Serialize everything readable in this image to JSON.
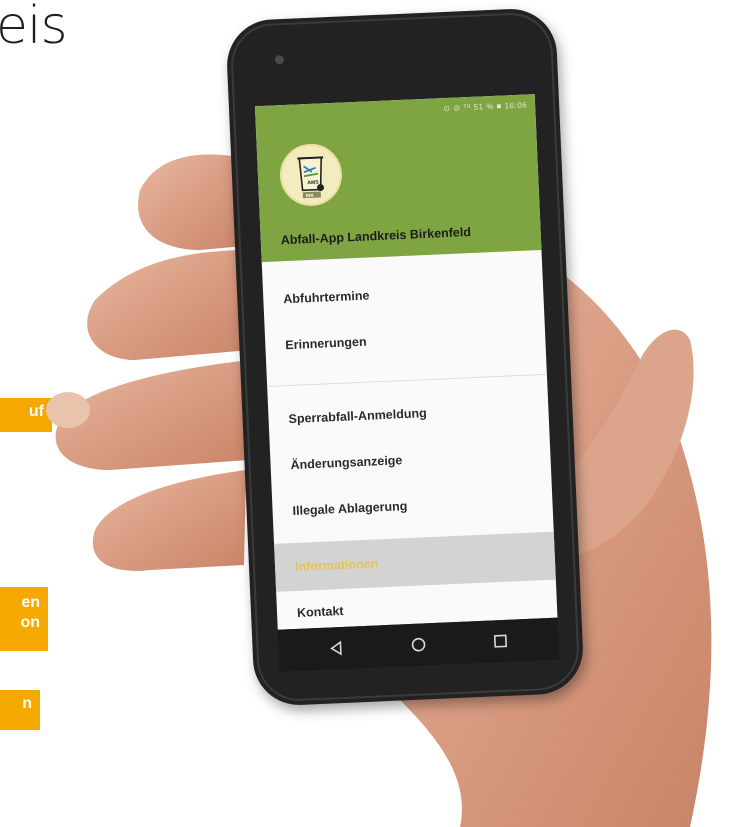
{
  "page": {
    "heading_fragment": "eis"
  },
  "side_badges": [
    {
      "text": "uf"
    },
    {
      "text_line1": "en",
      "text_line2": "on"
    },
    {
      "text": "n"
    }
  ],
  "colors": {
    "accent_orange": "#f5a800",
    "drawer_header_green": "#7ea542",
    "selected_row_gray": "#d3d3d3",
    "selected_text_yellow": "#e4c35a"
  },
  "phone": {
    "status_bar_text": "⊙ ⊘ ᵀᴵᴵ 51 % ■ 16:06",
    "header": {
      "logo_icon": "waste-bin-logo",
      "logo_caption": "BIR",
      "logo_text": "AWS",
      "title": "Abfall-App Landkreis Birkenfeld"
    },
    "menu_items": [
      {
        "label": "Abfuhrtermine"
      },
      {
        "label": "Erinnerungen"
      },
      {
        "label": "Sperrabfall-Anmeldung"
      },
      {
        "label": "Änderungsanzeige"
      },
      {
        "label": "Illegale Ablagerung"
      },
      {
        "label": "Informationen",
        "selected": true
      },
      {
        "label": "Kontakt"
      }
    ],
    "nav_bar": {
      "back_icon": "triangle-back-icon",
      "home_icon": "circle-home-icon",
      "recents_icon": "square-recents-icon"
    }
  }
}
